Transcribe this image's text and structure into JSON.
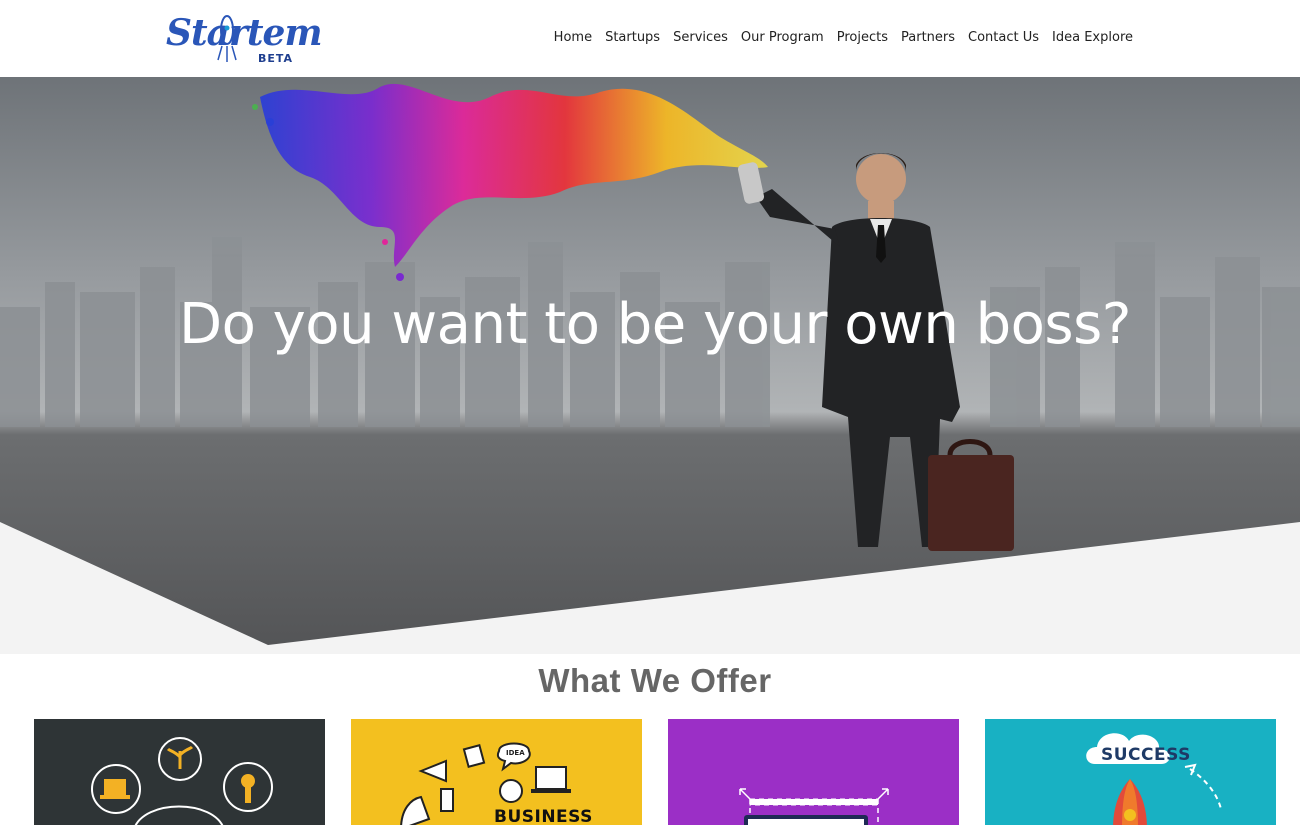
{
  "brand": {
    "logo_main": "Startem",
    "logo_tag": "BETA"
  },
  "nav": {
    "items": [
      "Home",
      "Startups",
      "Services",
      "Our Program",
      "Projects",
      "Partners",
      "Contact Us",
      "Idea Explore"
    ]
  },
  "hero": {
    "headline": "Do you want to be your own boss?"
  },
  "offer": {
    "title": "What We Offer",
    "cards": [
      {
        "color": "#2e3436",
        "icon": "network-ideas-icon"
      },
      {
        "color": "#f3c01f",
        "icon": "business-doodle-icon",
        "caption": "BUSINESS",
        "bubble": "IDEA"
      },
      {
        "color": "#9b2fc6",
        "icon": "screen-frame-icon"
      },
      {
        "color": "#18b1c3",
        "icon": "rocket-cloud-icon",
        "caption": "SUCCESS"
      }
    ]
  }
}
